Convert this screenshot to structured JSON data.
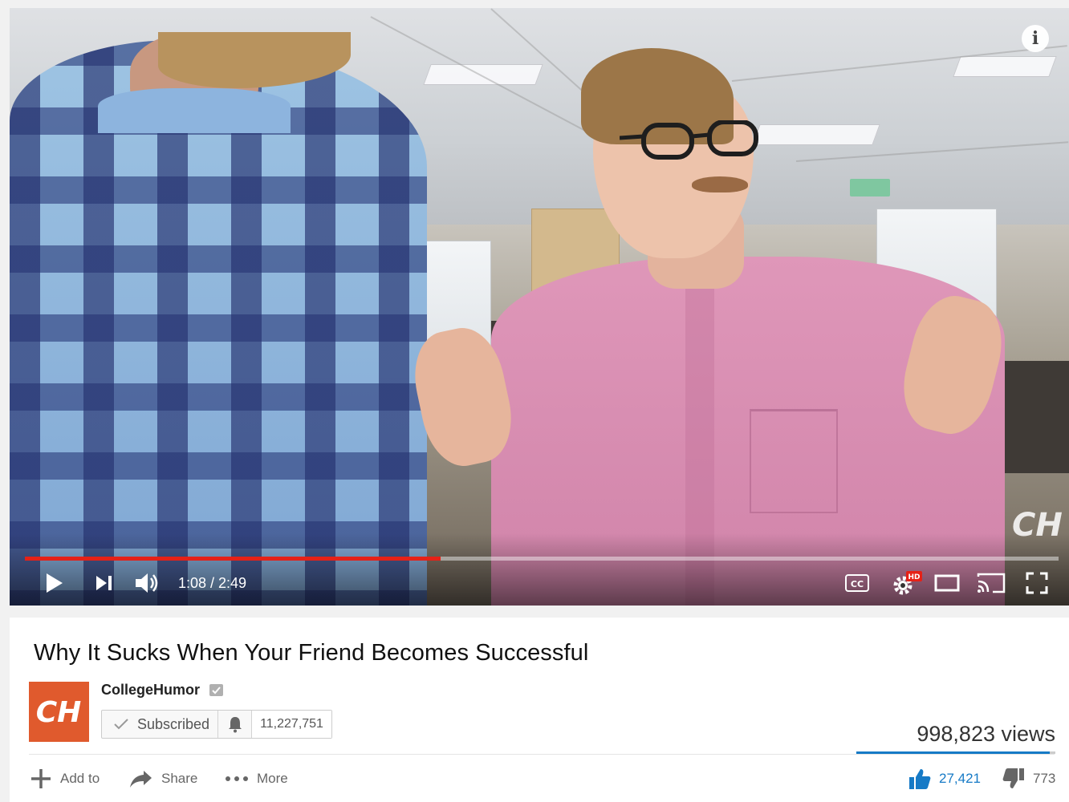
{
  "player": {
    "current_time": "1:08",
    "duration": "2:49",
    "time_display": "1:08 / 2:49",
    "progress_percent": 40.2,
    "hd_badge": "HD",
    "cc_label": "CC",
    "accent_color": "#e62117"
  },
  "video": {
    "title": "Why It Sucks When Your Friend Becomes Successful",
    "views": "998,823 views",
    "like_ratio_percent": 97
  },
  "channel": {
    "name": "CollegeHumor",
    "avatar_text": "CH",
    "avatar_color": "#e05a2d",
    "subscribe_label": "Subscribed",
    "subscriber_count": "11,227,751"
  },
  "actions": {
    "add_to": "Add to",
    "share": "Share",
    "more": "More",
    "likes": "27,421",
    "dislikes": "773",
    "like_color": "#167ac6"
  }
}
